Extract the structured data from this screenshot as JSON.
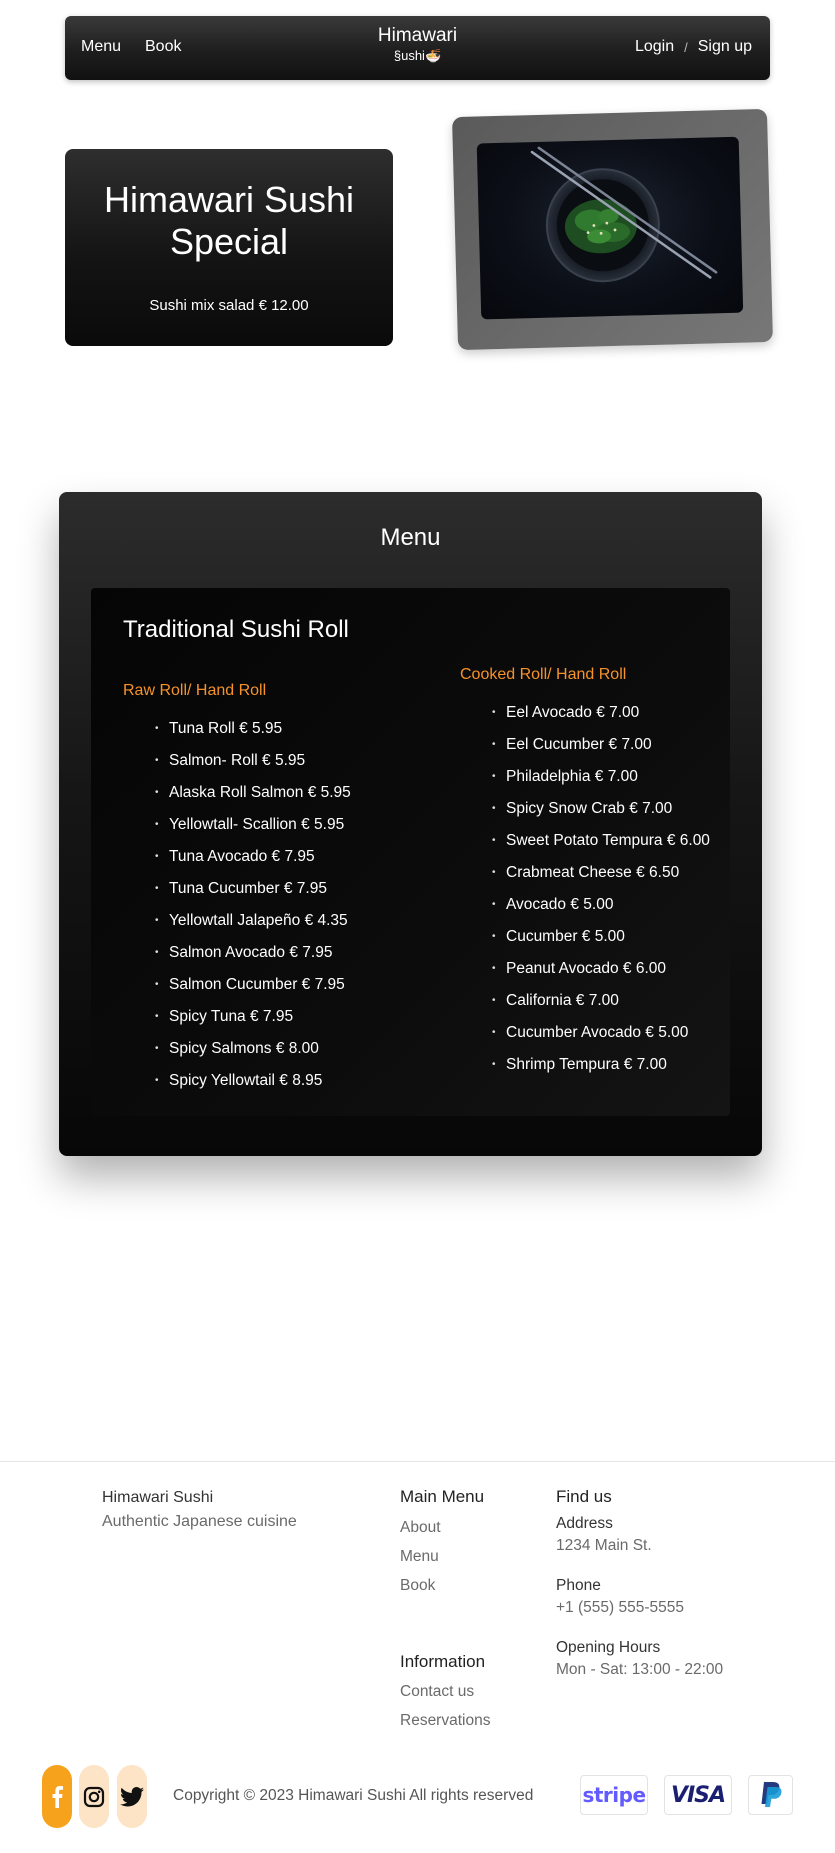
{
  "nav": {
    "menu_label": "Menu",
    "book_label": "Book",
    "brand_title": "Himawari",
    "brand_sub": "§ushi🍜",
    "login_label": "Login",
    "separator": "/",
    "signup_label": "Sign up"
  },
  "hero": {
    "title": "Himawari Sushi Special",
    "description": "Sushi mix salad € 12.00"
  },
  "menu": {
    "heading": "Menu",
    "subheading": "Traditional Sushi Roll",
    "raw": {
      "title": "Raw Roll/ Hand Roll",
      "items": [
        "Tuna Roll € 5.95",
        "Salmon- Roll € 5.95",
        "Alaska Roll Salmon € 5.95",
        "Yellowtall- Scallion € 5.95",
        "Tuna Avocado € 7.95",
        "Tuna Cucumber € 7.95",
        "Yellowtall Jalapeño € 4.35",
        "Salmon Avocado € 7.95",
        "Salmon Cucumber € 7.95",
        "Spicy Tuna € 7.95",
        "Spicy Salmons € 8.00",
        "Spicy Yellowtail € 8.95"
      ]
    },
    "cooked": {
      "title": "Cooked Roll/ Hand Roll",
      "items": [
        "Eel Avocado € 7.00",
        "Eel Cucumber € 7.00",
        "Philadelphia € 7.00",
        "Spicy Snow Crab € 7.00",
        "Sweet Potato Tempura € 6.00",
        "Crabmeat Cheese € 6.50",
        "Avocado € 5.00",
        "Cucumber € 5.00",
        "Peanut Avocado € 6.00",
        "California € 7.00",
        "Cucumber Avocado € 5.00",
        "Shrimp Tempura € 7.00"
      ]
    }
  },
  "footer": {
    "brand_name": "Himawari Sushi",
    "brand_tagline": "Authentic Japanese cuisine",
    "main_menu": {
      "title": "Main Menu",
      "links": [
        "About",
        "Menu",
        "Book"
      ]
    },
    "information": {
      "title": "Information",
      "links": [
        "Contact us",
        "Reservations"
      ]
    },
    "find_us": {
      "title": "Find us",
      "address_label": "Address",
      "address_value": "1234 Main St.",
      "phone_label": "Phone",
      "phone_value": "+1 (555) 555-5555",
      "hours_label": "Opening Hours",
      "hours_value": "Mon - Sat: 13:00 - 22:00"
    },
    "copyright": "Copyright © 2023 Himawari Sushi All rights reserved",
    "payments": {
      "stripe": "stripe",
      "visa": "VISA"
    },
    "social_icons": [
      "facebook-icon",
      "instagram-icon",
      "twitter-icon"
    ]
  },
  "colors": {
    "accent_orange": "#f5922b",
    "social_active": "#f7a21d",
    "social_inactive": "#fde4c6",
    "stripe": "#635bff",
    "visa": "#1a1f71"
  }
}
